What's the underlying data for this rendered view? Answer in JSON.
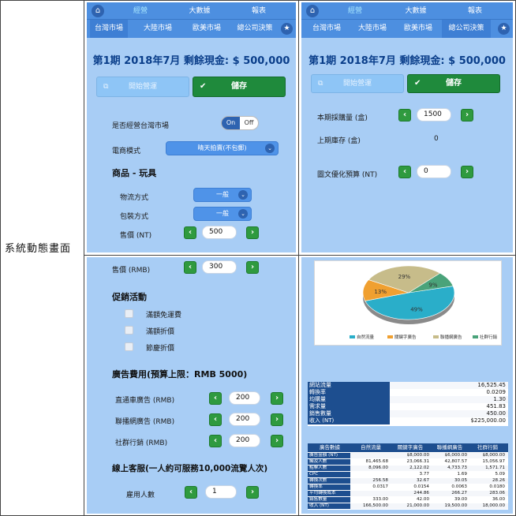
{
  "row_label": "系統動態畫面",
  "nav": {
    "top": [
      "經營",
      "大數據",
      "報表"
    ],
    "sub": [
      "台灣市場",
      "大陸市場",
      "歐美市場",
      "總公司決策"
    ]
  },
  "panel1": {
    "heading": "第1期 2018年7月 剩餘現金: $ 500,000",
    "start_btn": "開始營運",
    "save_btn": "儲存",
    "q_taiwan": "是否經營台灣市場",
    "toggle_on": "On",
    "toggle_off": "Off",
    "ecommerce_label": "電商模式",
    "ecommerce_value": "晴天拍賣(不包郵)",
    "section_title": "商品 - 玩具",
    "logistics_label": "物流方式",
    "logistics_value": "一般",
    "packaging_label": "包裝方式",
    "packaging_value": "一般",
    "price_label": "售價 (NT)",
    "price_value": "500"
  },
  "panel2": {
    "heading": "第1期 2018年7月 剩餘現金: $ 500,000",
    "start_btn": "開始營運",
    "save_btn": "儲存",
    "purchase_label": "本期採購量 (盒)",
    "purchase_value": "1500",
    "inventory_label": "上期庫存 (盒)",
    "inventory_value": "0",
    "graphic_label": "圖文優化預算 (NT)",
    "graphic_value": "0"
  },
  "panel3": {
    "price_label": "售價 (RMB)",
    "price_value": "300",
    "promo_title": "促銷活動",
    "promos": [
      "滿額免運費",
      "滿額折價",
      "節慶折價"
    ],
    "ad_title": "廣告費用(預算上限：RMB 5000)",
    "ads": [
      {
        "label": "直通車廣告 (RMB)",
        "value": "200"
      },
      {
        "label": "聯播網廣告 (RMB)",
        "value": "200"
      },
      {
        "label": "社群行銷 (RMB)",
        "value": "200"
      }
    ],
    "cs_title": "線上客服(一人約可服務10,000流覽人次)",
    "staff_label": "雇用人數",
    "staff_value": "1"
  },
  "chart_data": {
    "type": "pie",
    "categories": [
      "自然流量",
      "關鍵字廣告",
      "聯播網廣告",
      "社群行銷"
    ],
    "values": [
      49,
      13,
      29,
      9
    ],
    "slice_labels": [
      "49%",
      "13%",
      "29%",
      "9%"
    ],
    "legend_position": "bottom",
    "colors": [
      "#2aaec9",
      "#f0a030",
      "#c7bc8a",
      "#4aa37a"
    ]
  },
  "stats": [
    {
      "k": "網站流量",
      "v": "16,525.45"
    },
    {
      "k": "轉換率",
      "v": "0.0209"
    },
    {
      "k": "均購量",
      "v": "1.30"
    },
    {
      "k": "需求量",
      "v": "451.83"
    },
    {
      "k": "銷售數量",
      "v": "450.00"
    },
    {
      "k": "收入 (NT)",
      "v": "$225,000.00"
    }
  ],
  "ads_table": {
    "headers": [
      "廣告數據",
      "自然流量",
      "關鍵字廣告",
      "聯播網廣告",
      "社群行銷"
    ],
    "rows": [
      [
        "廣告金額 (NT)",
        "",
        "$8,000.00",
        "$6,000.00",
        "$8,000.00"
      ],
      [
        "觸及人數",
        "81,465.68",
        "23,066.31",
        "42,807.57",
        "15,056.97"
      ],
      [
        "點擊人數",
        "8,096.00",
        "2,122.02",
        "4,733.73",
        "1,571.71"
      ],
      [
        "CPC",
        "",
        "3.77",
        "1.69",
        "5.09"
      ],
      [
        "轉換次數",
        "256.58",
        "32.67",
        "30.05",
        "28.26"
      ],
      [
        "轉換率",
        "0.0317",
        "0.0154",
        "0.0063",
        "0.0180"
      ],
      [
        "平均轉換成本",
        "",
        "244.86",
        "266.27",
        "283.06"
      ],
      [
        "銷售數量",
        "333.00",
        "42.00",
        "39.00",
        "36.00"
      ],
      [
        "收入 (NT)",
        "166,500.00",
        "21,000.00",
        "19,500.00",
        "18,000.00"
      ]
    ]
  },
  "colors": {
    "panel_bg": "#a8cdf5",
    "nav_bg": "#4d8fe0",
    "heading": "#0a3e8a",
    "green": "#1f8a3c",
    "table_header": "#1d4e8f"
  }
}
